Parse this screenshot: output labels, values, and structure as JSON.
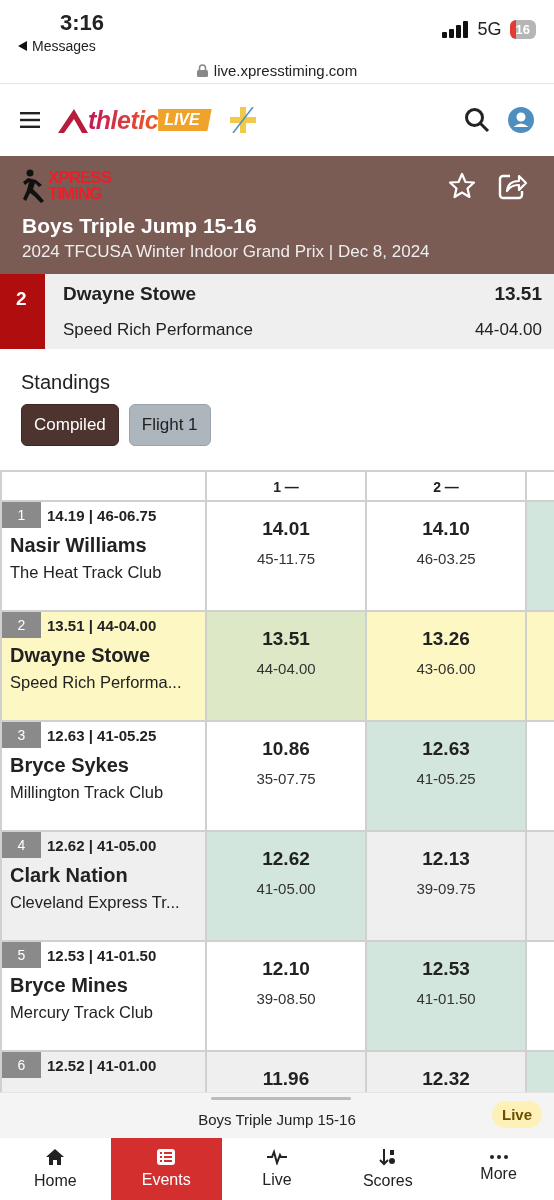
{
  "status_bar": {
    "time": "3:16",
    "back": "Messages",
    "network": "5G",
    "battery": "16"
  },
  "browser": {
    "url": "live.xpresstiming.com"
  },
  "header": {
    "logo_text": "thletic",
    "logo_badge": "LIVE"
  },
  "event": {
    "brand_top": "XPRESS",
    "brand_bottom": "TIMING",
    "title": "Boys Triple Jump 15-16",
    "subtitle": "2024 TFCUSA Winter Indoor Grand Prix | Dec 8, 2024"
  },
  "featured": {
    "place": "2",
    "name": "Dwayne Stowe",
    "team": "Speed Rich Performance",
    "mark": "13.51",
    "imperial": "44-04.00"
  },
  "standings": {
    "title": "Standings",
    "filters": [
      {
        "label": "Compiled",
        "selected": true
      },
      {
        "label": "Flight 1",
        "selected": false
      }
    ]
  },
  "table": {
    "columns": [
      "1 —",
      "2 —"
    ],
    "rows": [
      {
        "place": "1",
        "best": "14.19 | 46-06.75",
        "name": "Nasir Williams",
        "team": "The Heat Track Club",
        "selected": false,
        "shaded": false,
        "attempts": [
          {
            "mark": "14.01",
            "imperial": "45-11.75",
            "best": false
          },
          {
            "mark": "14.10",
            "imperial": "46-03.25",
            "best": false
          },
          {
            "best": true
          }
        ]
      },
      {
        "place": "2",
        "best": "13.51 | 44-04.00",
        "name": "Dwayne Stowe",
        "team": "Speed Rich Performa...",
        "selected": true,
        "shaded": false,
        "attempts": [
          {
            "mark": "13.51",
            "imperial": "44-04.00",
            "best": true
          },
          {
            "mark": "13.26",
            "imperial": "43-06.00",
            "best": false
          },
          {
            "best": false
          }
        ]
      },
      {
        "place": "3",
        "best": "12.63 | 41-05.25",
        "name": "Bryce Sykes",
        "team": "Millington Track Club",
        "selected": false,
        "shaded": false,
        "attempts": [
          {
            "mark": "10.86",
            "imperial": "35-07.75",
            "best": false
          },
          {
            "mark": "12.63",
            "imperial": "41-05.25",
            "best": true
          },
          {
            "best": false
          }
        ]
      },
      {
        "place": "4",
        "best": "12.62 | 41-05.00",
        "name": "Clark Nation",
        "team": "Cleveland Express Tr...",
        "selected": false,
        "shaded": true,
        "attempts": [
          {
            "mark": "12.62",
            "imperial": "41-05.00",
            "best": true
          },
          {
            "mark": "12.13",
            "imperial": "39-09.75",
            "best": false
          },
          {
            "best": false
          }
        ]
      },
      {
        "place": "5",
        "best": "12.53 | 41-01.50",
        "name": "Bryce Mines",
        "team": "Mercury Track Club",
        "selected": false,
        "shaded": false,
        "attempts": [
          {
            "mark": "12.10",
            "imperial": "39-08.50",
            "best": false
          },
          {
            "mark": "12.53",
            "imperial": "41-01.50",
            "best": true
          },
          {
            "best": false
          }
        ]
      },
      {
        "place": "6",
        "best": "12.52 | 41-01.00",
        "selected": false,
        "shaded": true,
        "attempts": [
          {
            "mark": "11.96",
            "best": false
          },
          {
            "mark": "12.32",
            "best": false
          },
          {
            "best": true
          }
        ]
      }
    ]
  },
  "mini_player": {
    "title": "Boys Triple Jump 15-16",
    "badge": "Live"
  },
  "tab_bar": [
    {
      "label": "Home",
      "kind": "home",
      "selected": false
    },
    {
      "label": "Events",
      "kind": "events",
      "selected": true
    },
    {
      "label": "Live",
      "kind": "live",
      "selected": false
    },
    {
      "label": "Scores",
      "kind": "scores",
      "selected": false
    },
    {
      "label": "More",
      "kind": "more",
      "selected": false
    }
  ]
}
